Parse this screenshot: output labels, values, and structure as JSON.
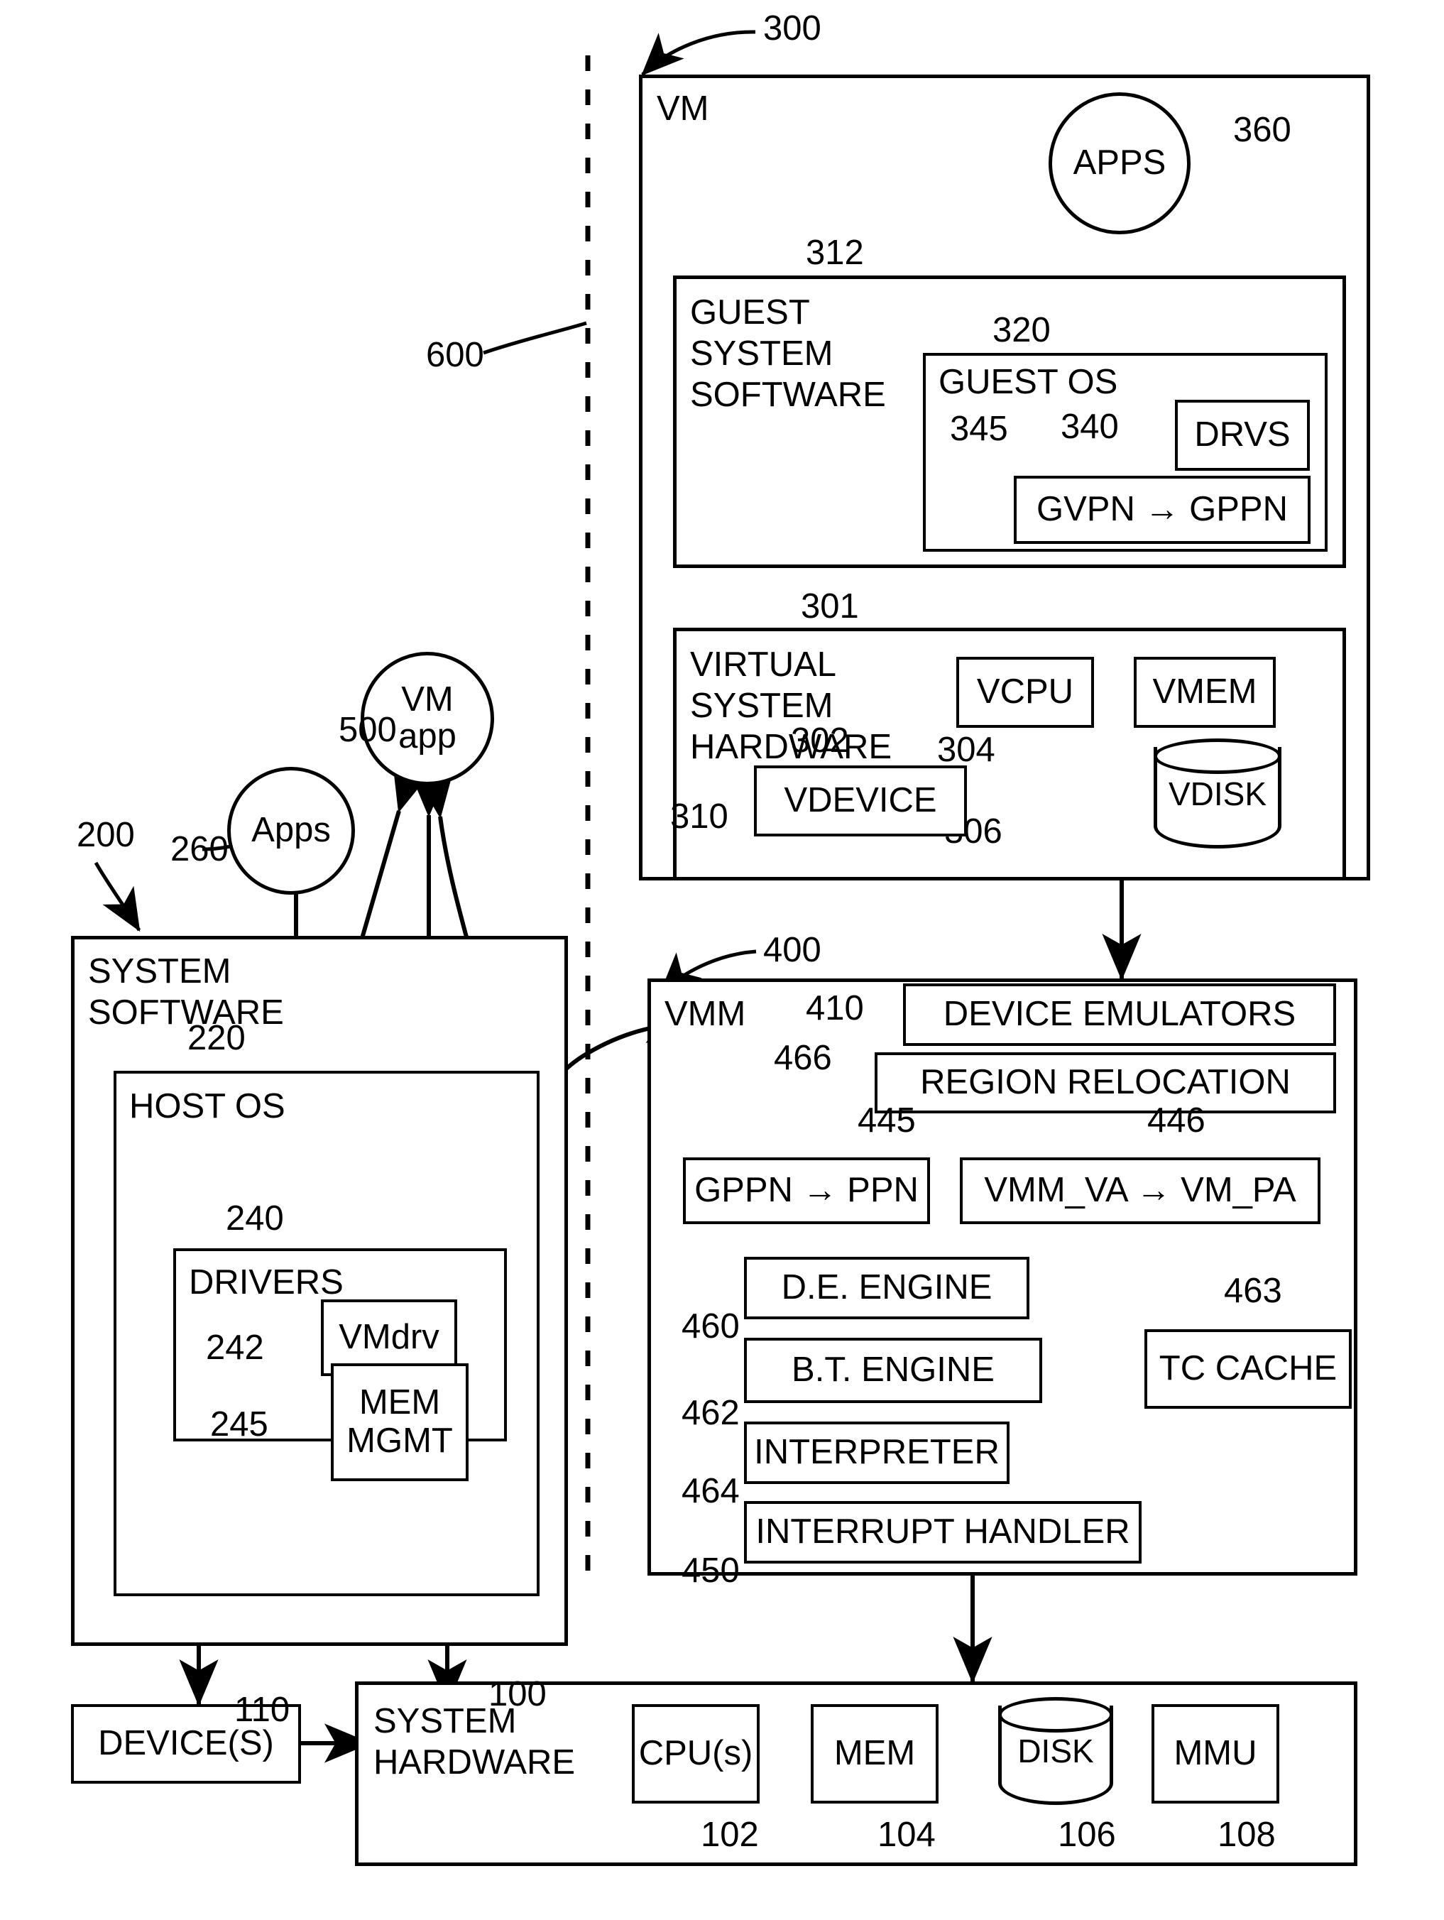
{
  "figure": {
    "kind": "patent-block-diagram",
    "subject": "Virtual machine / VMM / host system architecture"
  },
  "regions": {
    "vm": {
      "title": "VM",
      "ref": "300",
      "apps_circle": {
        "label": "APPS",
        "ref": "360"
      },
      "guest_system_software": {
        "title": "GUEST\nSYSTEM\nSOFTWARE",
        "ref": "312",
        "guest_os": {
          "title": "GUEST OS",
          "ref": "320",
          "drvs": {
            "label": "DRVS",
            "ref": "340"
          },
          "mapping": {
            "label": "GVPN → GPPN",
            "ref": "345"
          }
        }
      },
      "virtual_system_hardware": {
        "title": "VIRTUAL\nSYSTEM\nHARDWARE",
        "ref": "301",
        "items": [
          {
            "label": "VCPU",
            "ref": "302",
            "shape": "box"
          },
          {
            "label": "VMEM",
            "ref": "304",
            "shape": "box"
          },
          {
            "label": "VDISK",
            "ref": "306",
            "shape": "cylinder"
          },
          {
            "label": "VDEVICE",
            "ref": "310",
            "shape": "box"
          }
        ]
      }
    },
    "vmm": {
      "title": "VMM",
      "ref": "400",
      "items": [
        {
          "label": "DEVICE EMULATORS",
          "ref": "410"
        },
        {
          "label": "REGION RELOCATION",
          "ref": "466"
        },
        {
          "label": "GPPN → PPN",
          "ref": "445"
        },
        {
          "label": "VMM_VA → VM_PA",
          "ref": "446"
        },
        {
          "label": "D.E. ENGINE",
          "ref": "460"
        },
        {
          "label": "B.T. ENGINE",
          "ref": "462"
        },
        {
          "label": "TC CACHE",
          "ref": "463"
        },
        {
          "label": "INTERPRETER",
          "ref": "464"
        },
        {
          "label": "INTERRUPT HANDLER",
          "ref": "450"
        }
      ]
    },
    "system_software": {
      "title": "SYSTEM\nSOFTWARE",
      "ref": "200",
      "host_os": {
        "title": "HOST OS",
        "ref": "220",
        "drivers": {
          "title": "DRIVERS",
          "ref": "240",
          "vmdrv": {
            "label": "VMdrv",
            "ref": "242"
          }
        },
        "mem_mgmt": {
          "label": "MEM\nMGMT",
          "ref": "245"
        }
      },
      "apps_circle": {
        "label": "Apps",
        "ref": "260"
      }
    },
    "vm_app_circle": {
      "label": "VM\napp",
      "ref": "500"
    },
    "system_hardware": {
      "title": "SYSTEM\nHARDWARE",
      "ref": "100",
      "items": [
        {
          "label": "CPU(s)",
          "ref": "102",
          "shape": "box"
        },
        {
          "label": "MEM",
          "ref": "104",
          "shape": "box"
        },
        {
          "label": "DISK",
          "ref": "106",
          "shape": "cylinder"
        },
        {
          "label": "MMU",
          "ref": "108",
          "shape": "box"
        }
      ]
    },
    "devices": {
      "label": "DEVICE(S)",
      "ref": "110"
    },
    "divider": {
      "ref": "600"
    }
  }
}
